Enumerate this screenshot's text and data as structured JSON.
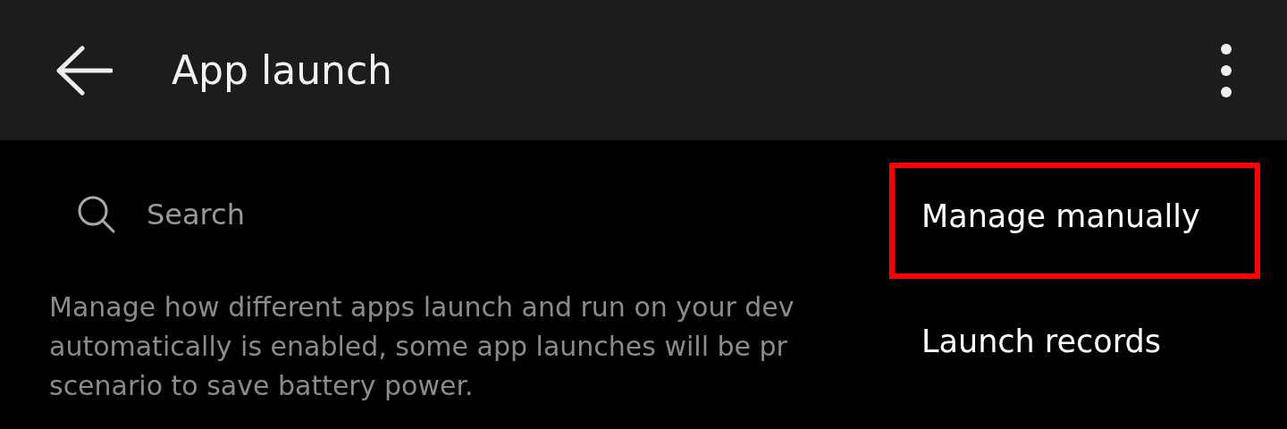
{
  "header": {
    "title": "App launch"
  },
  "search": {
    "placeholder": "Search"
  },
  "description": {
    "lines": [
      "Manage how different apps launch and run on your dev",
      "automatically is enabled, some app launches will be pr",
      "scenario to save battery power."
    ]
  },
  "menu": {
    "items": [
      {
        "label": "Manage manually",
        "highlighted": true
      },
      {
        "label": "Launch records",
        "highlighted": false
      }
    ]
  }
}
